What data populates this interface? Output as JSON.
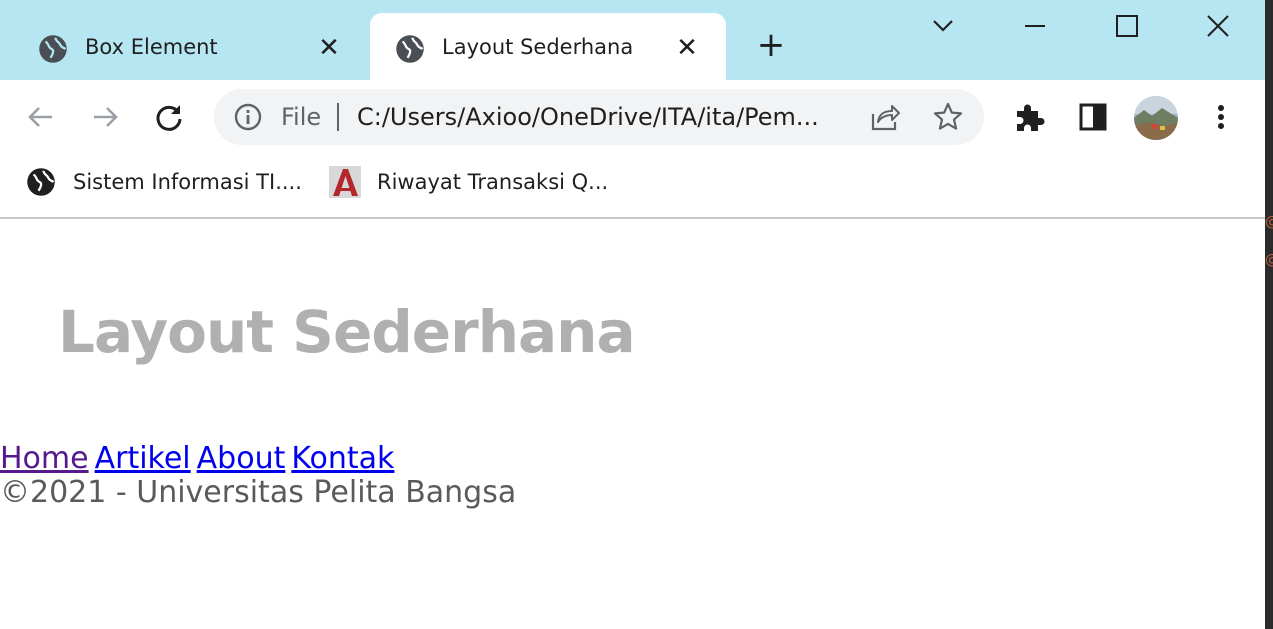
{
  "colors": {
    "tabbar_bg": "#b5e6f2",
    "heading": "#b0b0b0",
    "link": "#0000ee",
    "visited_link": "#551a8b",
    "footer_text": "#5a5a5a"
  },
  "tabs": [
    {
      "title": "Box Element",
      "icon": "globe-icon",
      "active": false
    },
    {
      "title": "Layout Sederhana",
      "icon": "globe-icon",
      "active": true
    }
  ],
  "toolbar": {
    "back_icon": "back-arrow-icon",
    "forward_icon": "forward-arrow-icon",
    "reload_icon": "reload-icon",
    "omnibox": {
      "scheme_label": "File",
      "url": "C:/Users/Axioo/OneDrive/ITA/ita/Pem..."
    }
  },
  "bookmarks": [
    {
      "label": "Sistem Informasi TI....",
      "icon": "globe-icon"
    },
    {
      "label": "Riwayat Transaksi Q...",
      "icon": "site-favicon"
    }
  ],
  "page": {
    "heading": "Layout Sederhana",
    "nav": [
      {
        "label": "Home",
        "visited": true
      },
      {
        "label": "Artikel",
        "visited": false
      },
      {
        "label": "About",
        "visited": false
      },
      {
        "label": "Kontak",
        "visited": false
      }
    ],
    "footer": "©2021 - Universitas Pelita Bangsa"
  }
}
